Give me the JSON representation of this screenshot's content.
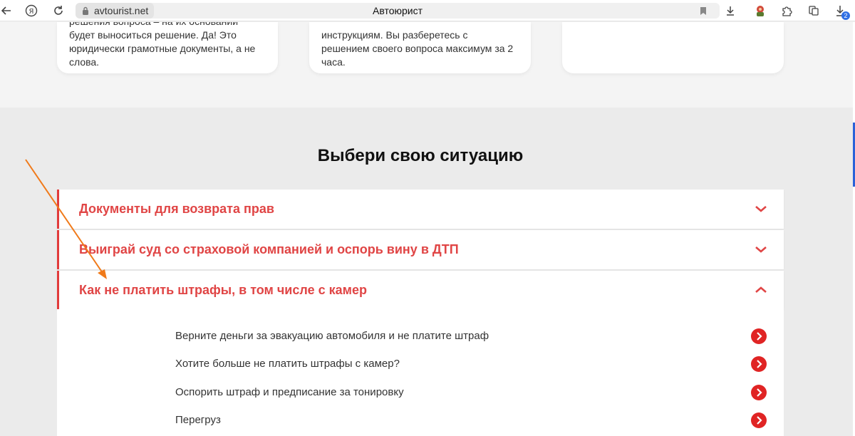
{
  "browser": {
    "domain": "avtourist.net",
    "title": "Автоюрист",
    "extension_badge": "2"
  },
  "cards": [
    {
      "text": "решения вопроса – на их основании будет выноситься решение. Да! Это юридически грамотные документы, а не слова."
    },
    {
      "text": "инструкциям. Вы разберетесь с решением своего вопроса максимум за 2 часа."
    },
    {
      "text": ""
    }
  ],
  "section": {
    "heading": "Выбери свою ситуацию"
  },
  "accordion": [
    {
      "title": "Документы для возврата прав",
      "expanded": false
    },
    {
      "title": "Выиграй суд со страховой компанией и оспорь вину в ДТП",
      "expanded": false
    },
    {
      "title": "Как не платить штрафы, в том числе с камер",
      "expanded": true
    }
  ],
  "sub_items": [
    "Верните деньги за эвакуацию автомобиля и не платите штраф",
    "Хотите больше не платить штрафы с камер?",
    "Оспорить штраф и предписание за тонировку",
    "Перегруз"
  ],
  "colors": {
    "accent": "#e04545",
    "button_red": "#e02424",
    "annotation_arrow": "#f07a1a"
  }
}
